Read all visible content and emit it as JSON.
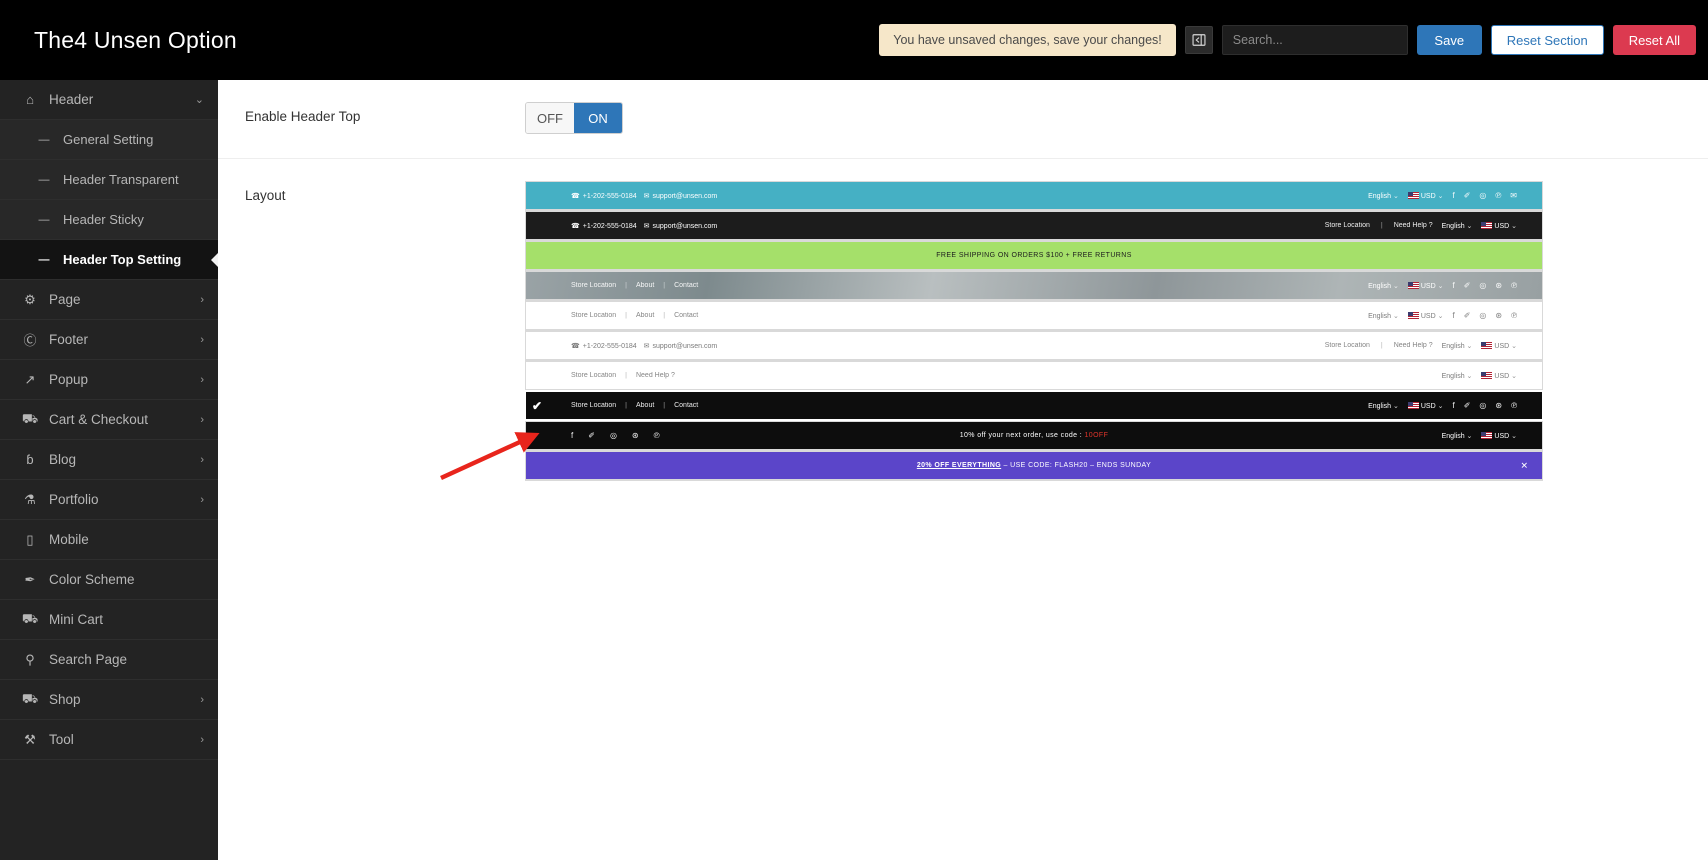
{
  "topbar": {
    "app_title": "The4 Unsen Option",
    "unsaved_notice": "You have unsaved changes, save your changes!",
    "collapse_icon": "collapse-panel-icon",
    "search_placeholder": "Search...",
    "search_value": "",
    "save_label": "Save",
    "reset_section_label": "Reset Section",
    "reset_all_label": "Reset All",
    "colors": {
      "save": "#2e76b8",
      "reset_all": "#dc3a50",
      "notice_bg": "#f6e7c9"
    }
  },
  "sidebar": {
    "items": [
      {
        "label": "Header",
        "icon": "home-icon",
        "caret": "⌄",
        "level": "top",
        "state": "expanded"
      },
      {
        "label": "General Setting",
        "icon": "dash-icon",
        "caret": "",
        "level": "sub",
        "state": ""
      },
      {
        "label": "Header Transparent",
        "icon": "dash-icon",
        "caret": "",
        "level": "sub",
        "state": ""
      },
      {
        "label": "Header Sticky",
        "icon": "dash-icon",
        "caret": "",
        "level": "sub",
        "state": ""
      },
      {
        "label": "Header Top Setting",
        "icon": "dash-icon",
        "caret": "",
        "level": "sub",
        "state": "active"
      },
      {
        "label": "Page",
        "icon": "gear-icon",
        "caret": "›",
        "level": "top",
        "state": ""
      },
      {
        "label": "Footer",
        "icon": "copyright-icon",
        "caret": "›",
        "level": "top",
        "state": ""
      },
      {
        "label": "Popup",
        "icon": "external-link-icon",
        "caret": "›",
        "level": "top",
        "state": ""
      },
      {
        "label": "Cart & Checkout",
        "icon": "basket-icon",
        "caret": "›",
        "level": "top",
        "state": ""
      },
      {
        "label": "Blog",
        "icon": "rss-icon",
        "caret": "›",
        "level": "top",
        "state": ""
      },
      {
        "label": "Portfolio",
        "icon": "flask-icon",
        "caret": "›",
        "level": "top",
        "state": ""
      },
      {
        "label": "Mobile",
        "icon": "mobile-icon",
        "caret": "",
        "level": "top",
        "state": ""
      },
      {
        "label": "Color Scheme",
        "icon": "paint-brush-icon",
        "caret": "",
        "level": "top",
        "state": ""
      },
      {
        "label": "Mini Cart",
        "icon": "basket-icon",
        "caret": "",
        "level": "top",
        "state": ""
      },
      {
        "label": "Search Page",
        "icon": "search-icon",
        "caret": "",
        "level": "top",
        "state": ""
      },
      {
        "label": "Shop",
        "icon": "basket-icon",
        "caret": "›",
        "level": "top",
        "state": ""
      },
      {
        "label": "Tool",
        "icon": "toolbox-icon",
        "caret": "›",
        "level": "top",
        "state": ""
      }
    ]
  },
  "main": {
    "enable_header_top": {
      "label": "Enable Header Top",
      "off_label": "OFF",
      "on_label": "ON",
      "value": "ON"
    },
    "layout": {
      "label": "Layout",
      "selected_index": 7,
      "rows": [
        {
          "id": "layout-1-teal",
          "style": "bg-teal",
          "phone": "+1-202-555-0184",
          "email": "support@unsen.com",
          "links": [],
          "center": "",
          "lang": "English",
          "currency": "USD",
          "socials": [
            "facebook",
            "twitter",
            "instagram",
            "pinterest",
            "email"
          ],
          "selected": false
        },
        {
          "id": "layout-2-dark",
          "style": "bg-dark",
          "phone": "+1-202-555-0184",
          "email": "support@unsen.com",
          "links": [
            "Store Location",
            "Need Help ?"
          ],
          "center": "",
          "lang": "English",
          "currency": "USD",
          "socials": [],
          "selected": false
        },
        {
          "id": "layout-3-green",
          "style": "bg-green",
          "phone": "",
          "email": "",
          "links": [],
          "center": "FREE SHIPPING ON ORDERS $100 + FREE RETURNS",
          "lang": "",
          "currency": "",
          "socials": [],
          "selected": false
        },
        {
          "id": "layout-4-photo",
          "style": "bg-photo",
          "phone": "",
          "email": "",
          "links": [
            "Store Location",
            "About",
            "Contact"
          ],
          "center": "",
          "lang": "English",
          "currency": "USD",
          "socials": [
            "facebook",
            "twitter",
            "instagram",
            "dribbble",
            "pinterest"
          ],
          "selected": false
        },
        {
          "id": "layout-5-white",
          "style": "bg-white",
          "phone": "",
          "email": "",
          "links": [
            "Store Location",
            "About",
            "Contact"
          ],
          "center": "",
          "lang": "English",
          "currency": "USD",
          "socials": [
            "facebook",
            "twitter",
            "instagram",
            "dribbble",
            "pinterest"
          ],
          "selected": false
        },
        {
          "id": "layout-6-white",
          "style": "bg-white",
          "phone": "+1-202-555-0184",
          "email": "support@unsen.com",
          "links": [
            "Store Location",
            "Need Help ?"
          ],
          "center": "",
          "lang": "English",
          "currency": "USD",
          "socials": [],
          "selected": false
        },
        {
          "id": "layout-7-white",
          "style": "bg-white",
          "phone": "",
          "email": "",
          "links": [
            "Store Location",
            "Need Help ?"
          ],
          "center": "",
          "lang": "English",
          "currency": "USD",
          "socials": [],
          "selected": false
        },
        {
          "id": "layout-8-black",
          "style": "bg-black",
          "phone": "",
          "email": "",
          "links": [
            "Store Location",
            "About",
            "Contact"
          ],
          "center": "",
          "lang": "English",
          "currency": "USD",
          "socials": [
            "facebook",
            "twitter",
            "instagram",
            "dribbble",
            "pinterest"
          ],
          "selected": true
        },
        {
          "id": "layout-9-black-social",
          "style": "bg-black",
          "phone": "",
          "email": "",
          "links": [],
          "center": "10% off your next order, use code : ",
          "center_code": "10OFF",
          "lang": "English",
          "currency": "USD",
          "socials_left": [
            "facebook",
            "twitter",
            "instagram",
            "dribbble",
            "pinterest"
          ],
          "socials": [],
          "selected": false
        },
        {
          "id": "layout-10-purple",
          "style": "bg-purple",
          "phone": "",
          "email": "",
          "links": [],
          "center_bold": "20% OFF EVERYTHING",
          "center": " – USE CODE: FLASH20 – ENDS SUNDAY",
          "lang": "",
          "currency": "",
          "socials": [],
          "close_icon": "close-icon",
          "selected": false
        }
      ]
    }
  },
  "annotation": {
    "arrow_color": "#e8251c",
    "arrow_name": "pointer-arrow"
  }
}
